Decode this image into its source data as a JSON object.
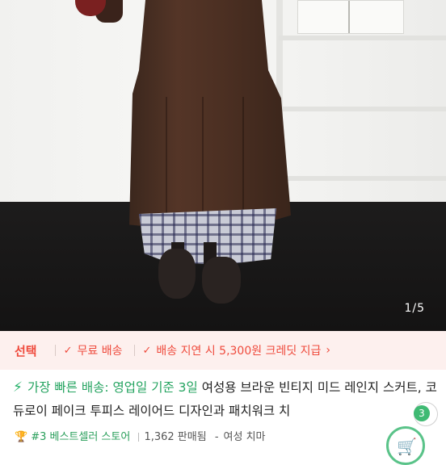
{
  "gallery": {
    "counter": "1/5"
  },
  "options": {
    "select_label": "선택",
    "free_shipping": "무료 배송",
    "delay_credit": "배송 지연 시 5,300원 크레딧 지급"
  },
  "product": {
    "fast_delivery": "가장 빠른 배송: 영업일 기준 3일",
    "title": "여성용 브라운 빈티지 미드 레인지 스커트, 코듀로이 페이크 투피스 레이어드 디자인과 패치워크 치",
    "rank": "#3 베스트셀러 스토어",
    "sold": "1,362 판매됨",
    "category": "여성 치마"
  },
  "cart": {
    "count": "3"
  },
  "colors": {
    "accent": "#ef4a3c",
    "green": "#26b26a",
    "option_bg": "#fdf0ee"
  },
  "icons": [
    "lightning-icon",
    "check-icon",
    "chevron-right-icon",
    "trophy-icon",
    "cart-icon",
    "chevron-down-icon"
  ]
}
